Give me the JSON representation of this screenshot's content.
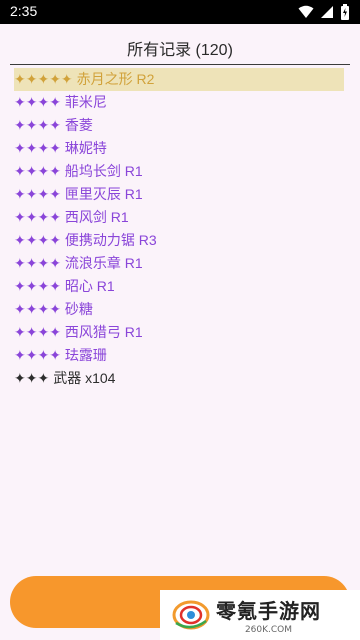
{
  "status_bar": {
    "time": "2:35"
  },
  "header": {
    "title": "所有记录 (120)"
  },
  "records": [
    {
      "stars": "✦✦✦✦✦",
      "name": "赤月之形 R2",
      "rarity": 5,
      "color": "#d1a23a",
      "highlighted": true
    },
    {
      "stars": "✦✦✦✦",
      "name": "菲米尼",
      "rarity": 4,
      "color": "#8a45d9"
    },
    {
      "stars": "✦✦✦✦",
      "name": "香菱",
      "rarity": 4,
      "color": "#8a45d9"
    },
    {
      "stars": "✦✦✦✦",
      "name": "琳妮特",
      "rarity": 4,
      "color": "#8a45d9"
    },
    {
      "stars": "✦✦✦✦",
      "name": "船坞长剑 R1",
      "rarity": 4,
      "color": "#8a45d9"
    },
    {
      "stars": "✦✦✦✦",
      "name": "匣里灭辰 R1",
      "rarity": 4,
      "color": "#8a45d9"
    },
    {
      "stars": "✦✦✦✦",
      "name": "西风剑 R1",
      "rarity": 4,
      "color": "#8a45d9"
    },
    {
      "stars": "✦✦✦✦",
      "name": "便携动力锯 R3",
      "rarity": 4,
      "color": "#8a45d9"
    },
    {
      "stars": "✦✦✦✦",
      "name": "流浪乐章 R1",
      "rarity": 4,
      "color": "#8a45d9"
    },
    {
      "stars": "✦✦✦✦",
      "name": "昭心 R1",
      "rarity": 4,
      "color": "#8a45d9"
    },
    {
      "stars": "✦✦✦✦",
      "name": "砂糖",
      "rarity": 4,
      "color": "#8a45d9"
    },
    {
      "stars": "✦✦✦✦",
      "name": "西风猎弓 R1",
      "rarity": 4,
      "color": "#8a45d9"
    },
    {
      "stars": "✦✦✦✦",
      "name": "珐露珊",
      "rarity": 4,
      "color": "#8a45d9"
    },
    {
      "stars": "✦✦✦",
      "name": "武器 x104",
      "rarity": 3,
      "color": "#2d2d2d"
    }
  ],
  "colors": {
    "accent_button": "#f7972c",
    "background": "#fbf3fa"
  },
  "watermark": {
    "title": "零氪手游网",
    "subtitle": "260K.COM",
    "icon": "logo-icon"
  }
}
